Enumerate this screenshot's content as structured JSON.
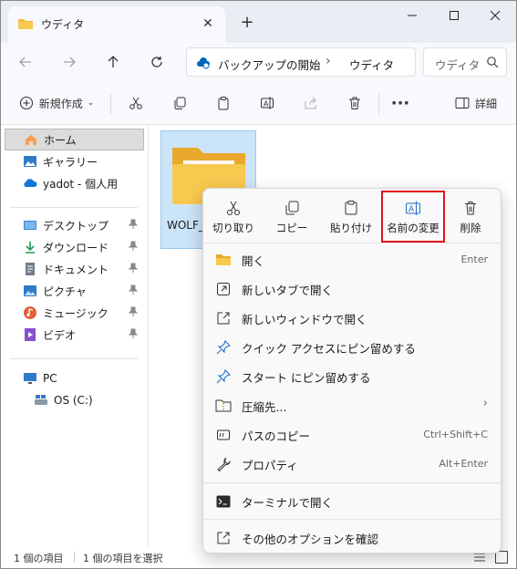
{
  "tab": {
    "title": "ウディタ"
  },
  "address": {
    "crumbs": [
      "バックアップの開始",
      "ウディタ"
    ]
  },
  "search": {
    "placeholder": "ウディタ"
  },
  "commandbar": {
    "new_label": "新規作成",
    "details_label": "詳細"
  },
  "sidebar": {
    "items": [
      {
        "label": "ホーム",
        "icon": "home-icon"
      },
      {
        "label": "ギャラリー",
        "icon": "gallery-icon"
      },
      {
        "label": "yadot - 個人用",
        "icon": "onedrive-icon"
      },
      {
        "label": "デスクトップ",
        "icon": "desktop-icon"
      },
      {
        "label": "ダウンロード",
        "icon": "download-icon"
      },
      {
        "label": "ドキュメント",
        "icon": "documents-icon"
      },
      {
        "label": "ピクチャ",
        "icon": "pictures-icon"
      },
      {
        "label": "ミュージック",
        "icon": "music-icon"
      },
      {
        "label": "ビデオ",
        "icon": "videos-icon"
      },
      {
        "label": "PC",
        "icon": "pc-icon"
      },
      {
        "label": "OS (C:)",
        "icon": "drive-icon"
      }
    ]
  },
  "content": {
    "folder_name": "WOLF_"
  },
  "status": {
    "count": "1 個の項目",
    "selected": "1 個の項目を選択"
  },
  "context_menu": {
    "actions": [
      {
        "label": "切り取り",
        "icon": "cut-icon"
      },
      {
        "label": "コピー",
        "icon": "copy-icon"
      },
      {
        "label": "貼り付け",
        "icon": "paste-icon"
      },
      {
        "label": "名前の変更",
        "icon": "rename-icon"
      },
      {
        "label": "削除",
        "icon": "delete-icon"
      }
    ],
    "items": [
      {
        "label": "開く",
        "shortcut": "Enter"
      },
      {
        "label": "新しいタブで開く",
        "shortcut": ""
      },
      {
        "label": "新しいウィンドウで開く",
        "shortcut": ""
      },
      {
        "label": "クイック アクセスにピン留めする",
        "shortcut": ""
      },
      {
        "label": "スタート にピン留めする",
        "shortcut": ""
      },
      {
        "label": "圧縮先...",
        "shortcut": ""
      },
      {
        "label": "パスのコピー",
        "shortcut": "Ctrl+Shift+C"
      },
      {
        "label": "プロパティ",
        "shortcut": "Alt+Enter"
      },
      {
        "label": "ターミナルで開く",
        "shortcut": ""
      },
      {
        "label": "その他のオプションを確認",
        "shortcut": ""
      }
    ]
  },
  "colors": {
    "accent": "#0067c0",
    "folder": "#f8c94f",
    "highlight_border": "#e0131a",
    "selection": "#cce4f7"
  }
}
